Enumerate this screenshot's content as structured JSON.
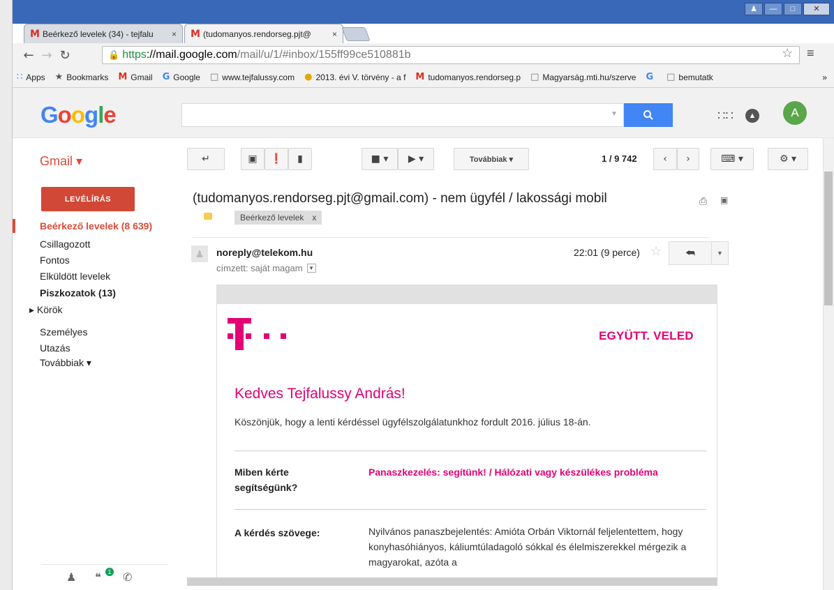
{
  "browser": {
    "tabs": [
      {
        "label": "Beérkező levelek (34) - tejfalu",
        "close": "×"
      },
      {
        "label": "(tudomanyos.rendorseg.pjt@",
        "close": "×"
      }
    ],
    "url": {
      "scheme": "https",
      "sep": "://",
      "host": "mail.google.com",
      "path": "/mail/u/1/#inbox/155ff99ce510881b"
    },
    "bookmarks": [
      {
        "label": "Apps",
        "icon": "apps-grid-icon"
      },
      {
        "label": "Bookmarks",
        "icon": "star-icon"
      },
      {
        "label": "Gmail",
        "icon": "gmail-icon"
      },
      {
        "label": "Google",
        "icon": "google-icon"
      },
      {
        "label": "www.tejfalussy.com",
        "icon": "page-icon"
      },
      {
        "label": "2013. évi V. törvény - a f",
        "icon": "globe-icon"
      },
      {
        "label": "tudomanyos.rendorseg.p",
        "icon": "gmail-icon"
      },
      {
        "label": "Magyarság.mti.hu/szerve",
        "icon": "page-icon"
      },
      {
        "label": "",
        "icon": "google-icon"
      },
      {
        "label": "bemutatk",
        "icon": "page-icon"
      }
    ],
    "bookmarks_more": "»"
  },
  "google": {
    "logo": [
      "G",
      "o",
      "o",
      "g",
      "l",
      "e"
    ],
    "logo_colors": [
      "#4285f4",
      "#ea4335",
      "#fbbc05",
      "#4285f4",
      "#34a853",
      "#ea4335"
    ],
    "avatar_letter": "A"
  },
  "gmail": {
    "label": "Gmail ▾",
    "more_button": "Továbbiak ▾",
    "pager": "1 / 9 742",
    "compose": "LEVÉLÍRÁS",
    "sidebar": [
      {
        "label": "Beérkező levelek (8 639)",
        "style": "inbox"
      },
      {
        "label": "Csillagozott",
        "style": ""
      },
      {
        "label": "Fontos",
        "style": ""
      },
      {
        "label": "Elküldött levelek",
        "style": ""
      },
      {
        "label": "Piszkozatok (13)",
        "style": "bold"
      },
      {
        "label": "▸ Körök",
        "style": ""
      },
      {
        "label": "Személyes",
        "style": ""
      },
      {
        "label": "Utazás",
        "style": ""
      },
      {
        "label": "Továbbiak ▾",
        "style": ""
      }
    ],
    "hangout_badge": "1"
  },
  "message": {
    "subject": "(tudomanyos.rendorseg.pjt@gmail.com) - nem ügyfél / lakossági mobil",
    "label_chip": "Beérkező levelek",
    "label_chip_close": "x",
    "sender": "noreply@telekom.hu",
    "to": "címzett: saját magam",
    "time": "22:01 (9 perce)"
  },
  "email_body": {
    "brand_color": "#e20074",
    "slogan": "EGYÜTT. VELED",
    "greeting": "Kedves Tejfalussy András!",
    "thanks": "Köszönjük, hogy a lenti kérdéssel ügyfélszolgálatunkhoz fordult 2016. július 18-án.",
    "q1_label": "Miben kérte segítségünk?",
    "q1_value": "Panaszkezelés: segítünk! / Hálózati vagy készülékes probléma",
    "q2_label": "A kérdés szövege:",
    "q2_value": "Nyilvános panaszbejelentés: Amióta Orbán Viktornál feljelentettem, hogy konyhasóhiányos, káliumtúladagoló sókkal és élelmiszerekkel mérgezik a magyarokat, azóta a"
  }
}
